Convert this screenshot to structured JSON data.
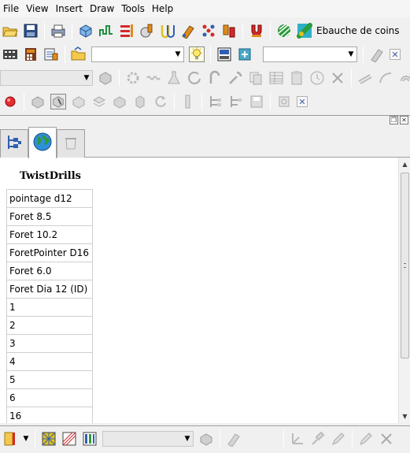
{
  "menu": {
    "items": [
      {
        "label": "File"
      },
      {
        "label": "View"
      },
      {
        "label": "Insert"
      },
      {
        "label": "Draw"
      },
      {
        "label": "Tools"
      },
      {
        "label": "Help"
      }
    ]
  },
  "toolbar1": {
    "ebauche_label": "Ebauche de coins"
  },
  "table": {
    "title": "TwistDrills",
    "rows": [
      "pointage d12",
      "Foret 8.5",
      "Foret 10.2",
      "ForetPointer D16",
      "Foret 6.0",
      "Foret Dia 12 (ID)",
      "1",
      "2",
      "3",
      "4",
      "5",
      "6",
      "16"
    ]
  },
  "colors": {
    "accent_blue": "#2f5fb3",
    "icon_orange": "#e08a1e",
    "icon_green": "#2e9b3c",
    "icon_red": "#d42a2a"
  }
}
